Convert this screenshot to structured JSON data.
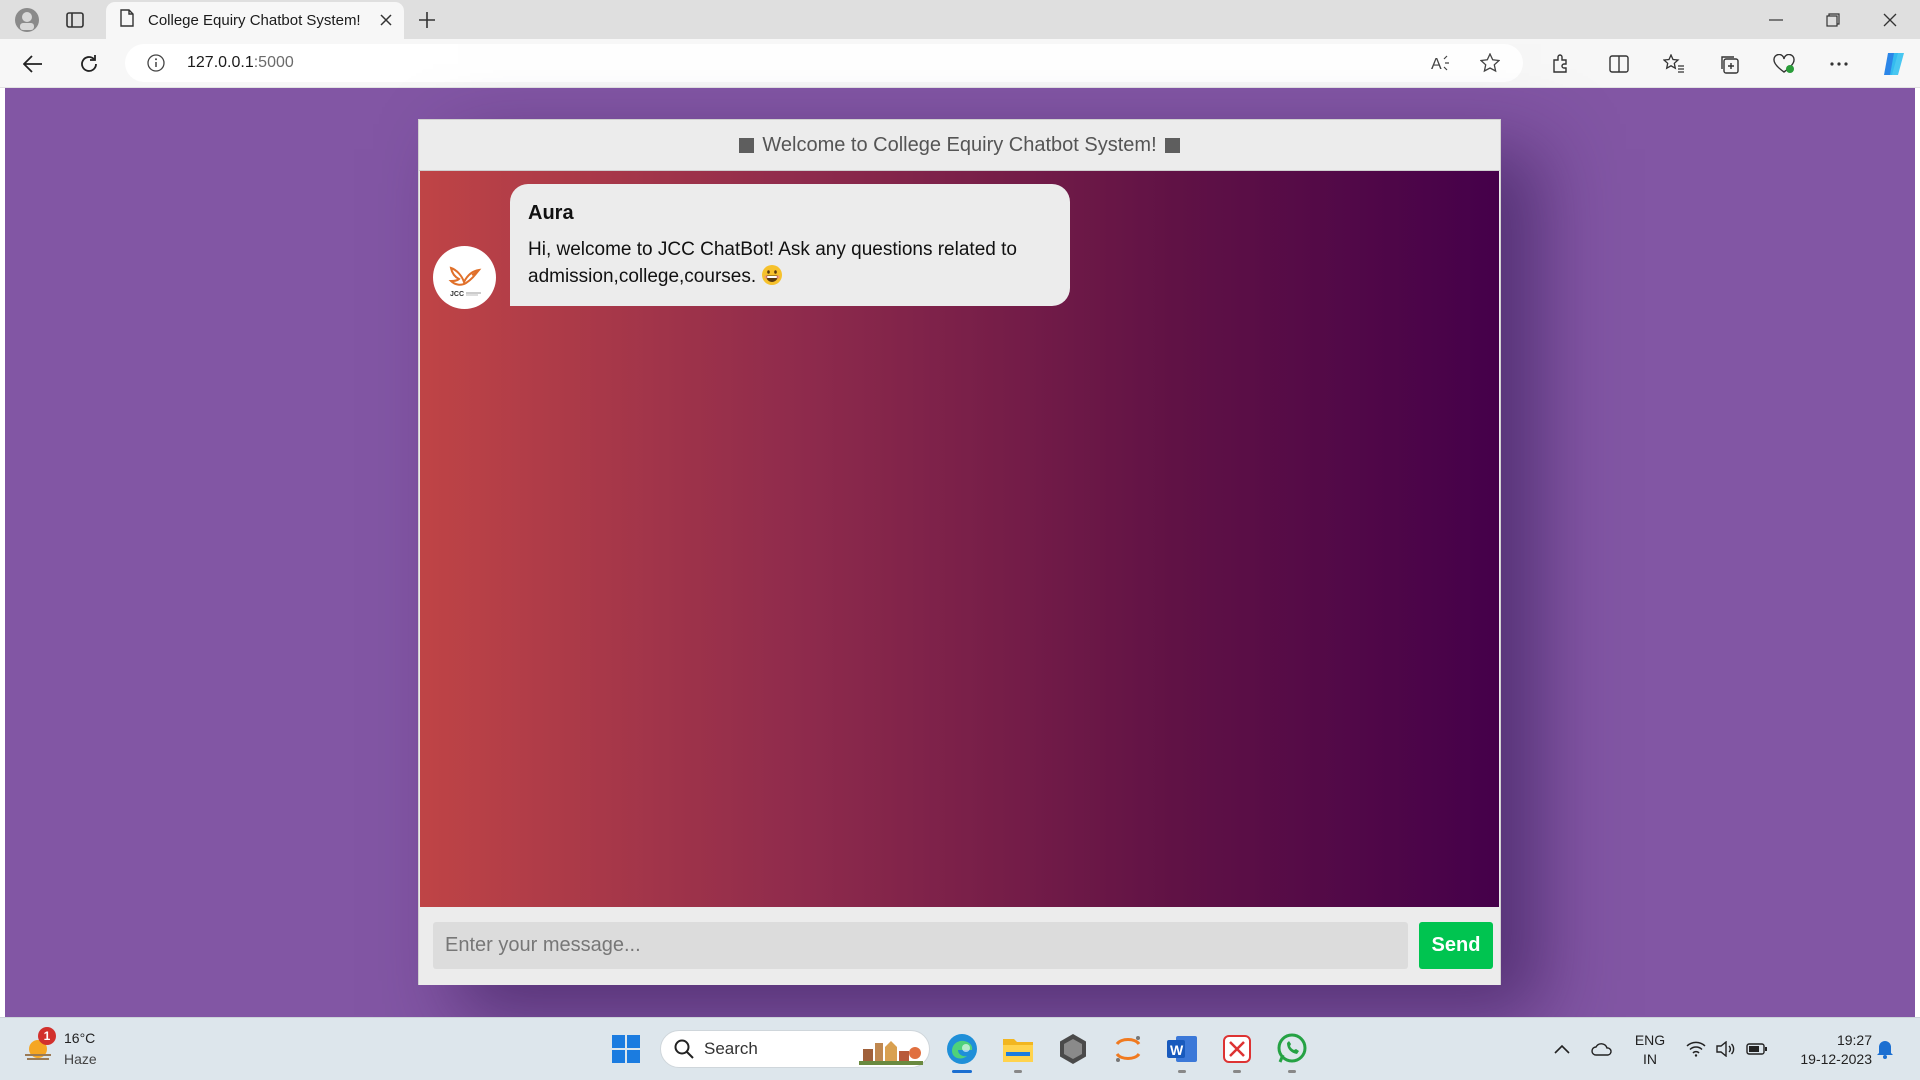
{
  "browser": {
    "tab_title": "College Equiry Chatbot System!",
    "url_host": "127.0.0.1",
    "url_port": ":5000"
  },
  "chat": {
    "header_title": "Welcome to College Equiry Chatbot System!",
    "message": {
      "sender": "Aura",
      "text": "Hi, welcome to JCC ChatBot! Ask any questions related to admission,college,courses.",
      "emoji": "grinning-face"
    },
    "avatar_logo_text": "JCC",
    "input_placeholder": "Enter your message...",
    "send_label": "Send"
  },
  "colors": {
    "page_background": "#8256a4",
    "chat_gradient_start": "#bf4446",
    "chat_gradient_end": "#45004a",
    "send_button": "#00c450"
  },
  "taskbar": {
    "weather_badge": "1",
    "temperature": "16°C",
    "condition": "Haze",
    "search_label": "Search",
    "language_line1": "ENG",
    "language_line2": "IN",
    "time": "19:27",
    "date": "19-12-2023"
  }
}
